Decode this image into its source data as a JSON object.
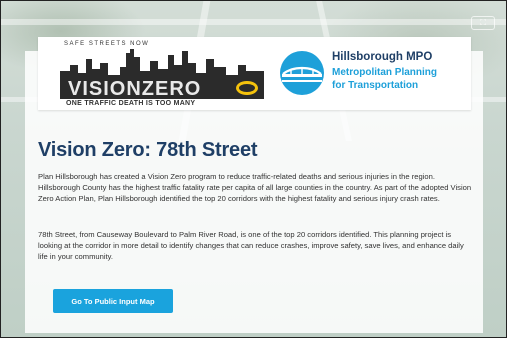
{
  "header": {
    "visionzero_logo": {
      "tagline": "SAFE STREETS NOW",
      "wordmark": "VISIONZERO",
      "slogan": "ONE TRAFFIC DEATH IS TOO MANY",
      "accent_color": "#f4c20d"
    },
    "mpo_logo": {
      "title": "Hillsborough MPO",
      "subtitle_line1": "Metropolitan Planning",
      "subtitle_line2": "for Transportation",
      "icon": "bridge-globe-icon",
      "title_color": "#1f3f66",
      "subtitle_color": "#1ea0d9"
    }
  },
  "main": {
    "title": "Vision Zero: 78th Street",
    "paragraph1": "Plan Hillsborough has created a Vision Zero program to reduce traffic-related deaths and serious injuries in the region. Hillsborough County has the highest traffic fatality rate per capita of all large counties in the country. As part of the adopted Vision Zero Action Plan, Plan Hillsborough identified the top 20 corridors with the highest fatality and serious injury crash rates.",
    "paragraph2": "78th Street, from Causeway Boulevard to Palm River Road, is one of the top 20 corridors identified. This planning project is looking at the corridor in more detail to identify changes that can reduce crashes, improve safety, save lives, and enhance daily life in your community.",
    "cta_label": "Go To Public Input Map",
    "cta_color": "#1aa3dd"
  }
}
